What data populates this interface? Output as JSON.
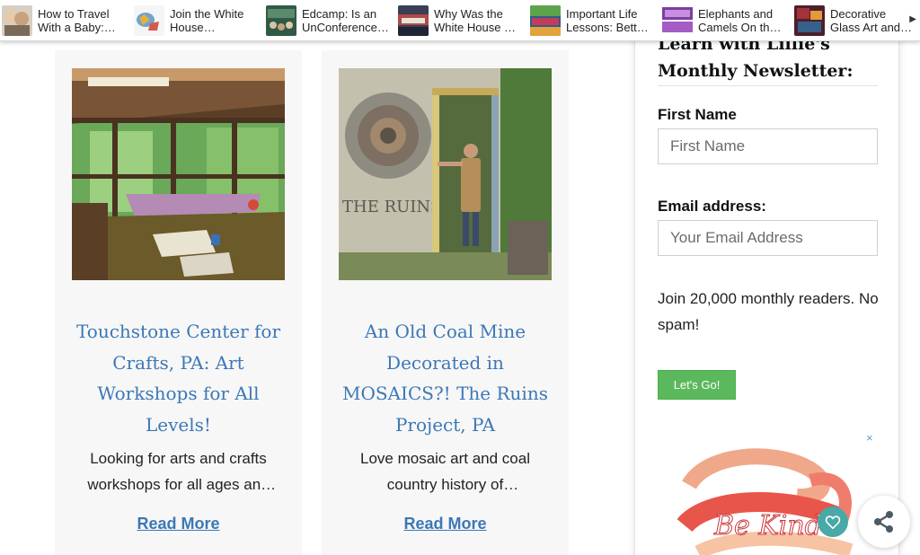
{
  "related_posts": [
    {
      "title": "How to Travel With a Baby: Tips",
      "thumb_icon": "baby-travel-thumbnail",
      "color": "#9c8a74"
    },
    {
      "title": "Join the White House Wonderfest",
      "thumb_icon": "white-house-thumbnail",
      "color": "#6fa3d2"
    },
    {
      "title": "Edcamp: Is an UnConference Right for You?",
      "thumb_icon": "edcamp-thumbnail",
      "color": "#2f5a45"
    },
    {
      "title": "Why Was the White House Lit Up?",
      "thumb_icon": "white-house-event-thumbnail",
      "color": "#b04a4a"
    },
    {
      "title": "Important Life Lessons: Better Lives",
      "thumb_icon": "life-lessons-thumbnail",
      "color": "#c43c5b"
    },
    {
      "title": "Elephants and Camels On the Move",
      "thumb_icon": "round-world-thumbnail",
      "color": "#7b3fa0"
    },
    {
      "title": "Decorative Glass Art and Design",
      "thumb_icon": "glass-art-thumbnail",
      "color": "#a6323c"
    }
  ],
  "posts": [
    {
      "title": "Touchstone Center for Crafts, PA: Art Workshops for All Levels!",
      "excerpt": "Looking for arts and crafts workshops for all ages and levels?",
      "read_more": "Read More",
      "image_icon": "craft-studio-pavilion-photo"
    },
    {
      "title": "An Old Coal Mine Decorated in MOSAICS?! The Ruins Project, PA",
      "excerpt": "Love mosaic art and coal country history of Pennsylvania?",
      "read_more": "Read More",
      "image_icon": "ruins-mosaic-doorway-photo",
      "image_text": "THE RUINS"
    }
  ],
  "newsletter": {
    "heading": "Learn with Lillie's Monthly Newsletter:",
    "first_name_label": "First Name",
    "first_name_placeholder": "First Name",
    "email_label": "Email address:",
    "email_placeholder": "Your Email Address",
    "blurb": "Join 20,000 monthly readers. No spam!",
    "button": "Let's Go!"
  },
  "ad": {
    "close_label": "×",
    "art_text": "Be Kind"
  },
  "icons": {
    "carousel_next": "▶",
    "favorite": "heart-icon",
    "share": "share-icon"
  },
  "colors": {
    "link": "#3b78b6",
    "button_green": "#5cb85c",
    "heart_teal": "#48a9a6"
  }
}
